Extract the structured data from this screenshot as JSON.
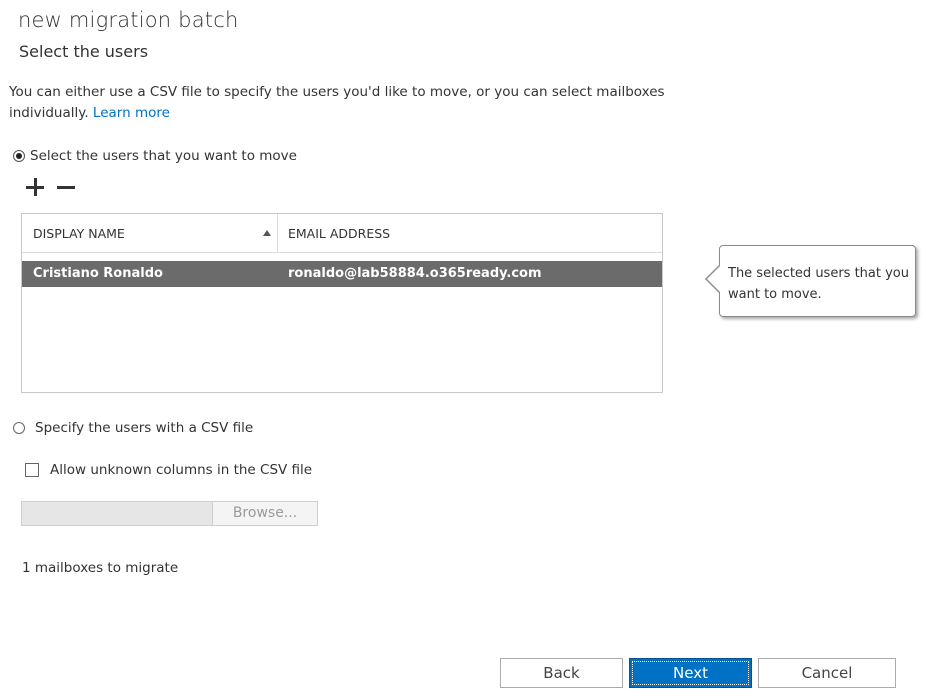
{
  "header": {
    "title": "new migration batch",
    "subtitle": "Select the users"
  },
  "description": {
    "text": "You can either use a CSV file to specify the users you'd like to move, or you can select mailboxes individually.",
    "link": "Learn more"
  },
  "select_users": {
    "radio_label": "Select the users that you want to move",
    "selected": true,
    "toolbar": {
      "add_symbol": "+",
      "remove_symbol": "−"
    },
    "table": {
      "columns": [
        "DISPLAY NAME",
        "EMAIL ADDRESS"
      ],
      "sort_column": "DISPLAY NAME",
      "sort_direction": "ascending",
      "rows": [
        {
          "display_name": "Cristiano Ronaldo",
          "email": "ronaldo@lab58884.o365ready.com",
          "selected": true
        }
      ]
    },
    "callout": "The selected users that you want to move."
  },
  "csv": {
    "radio_label": "Specify the users with a CSV file",
    "selected": false,
    "allow_unknown_label": "Allow unknown columns in the CSV file",
    "allow_unknown_checked": false,
    "file_path": "",
    "browse_label": "Browse..."
  },
  "status": {
    "mailbox_count_text": "1 mailboxes to migrate"
  },
  "footer": {
    "back_label": "Back",
    "next_label": "Next",
    "cancel_label": "Cancel"
  },
  "colors": {
    "accent": "#0072c6",
    "selected_row": "#6b6b6b"
  }
}
